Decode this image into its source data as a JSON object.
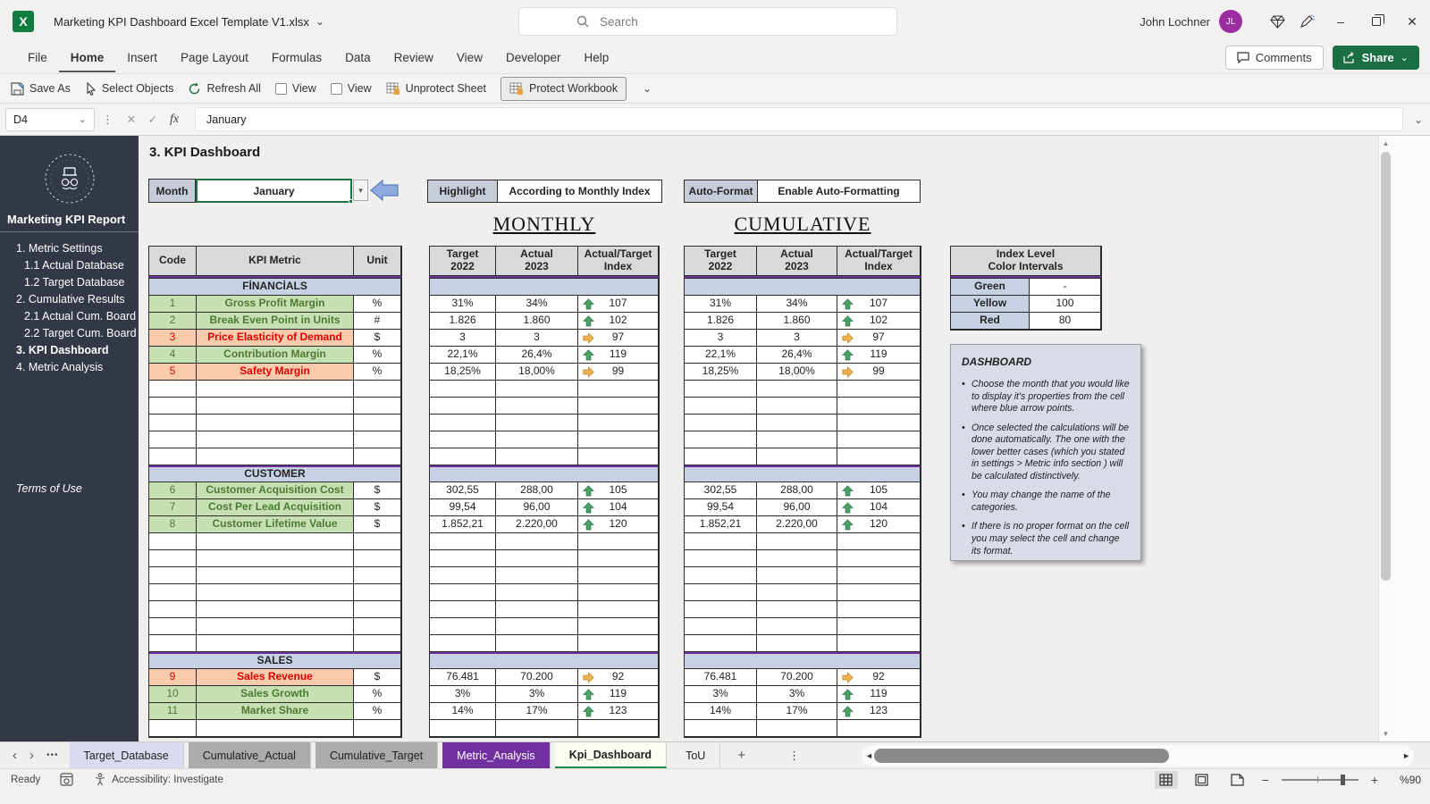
{
  "titlebar": {
    "document_title": "Marketing KPI Dashboard Excel Template V1.xlsx",
    "search_placeholder": "Search",
    "user_name": "John Lochner",
    "user_initials": "JL"
  },
  "menubar": {
    "items": [
      "File",
      "Home",
      "Insert",
      "Page Layout",
      "Formulas",
      "Data",
      "Review",
      "View",
      "Developer",
      "Help"
    ],
    "active_item": "Home",
    "comments_label": "Comments",
    "share_label": "Share"
  },
  "toolbar": {
    "save_as": "Save As",
    "select_objects": "Select Objects",
    "refresh_all": "Refresh All",
    "view_1": "View",
    "view_2": "View",
    "unprotect_sheet": "Unprotect Sheet",
    "protect_workbook": "Protect Workbook"
  },
  "formula_bar": {
    "name_box": "D4",
    "fx_label": "fx",
    "content": "January"
  },
  "sidebar": {
    "report_title": "Marketing KPI Report",
    "items": [
      {
        "label": "1. Metric Settings",
        "level": 0,
        "active": false
      },
      {
        "label": "1.1 Actual Database",
        "level": 1,
        "active": false
      },
      {
        "label": "1.2 Target Database",
        "level": 1,
        "active": false
      },
      {
        "label": "2. Cumulative Results",
        "level": 0,
        "active": false
      },
      {
        "label": "2.1 Actual Cum. Board",
        "level": 1,
        "active": false
      },
      {
        "label": "2.2 Target Cum. Board",
        "level": 1,
        "active": false
      },
      {
        "label": "3. KPI Dashboard",
        "level": 0,
        "active": true
      },
      {
        "label": "4. Metric Analysis",
        "level": 0,
        "active": false
      }
    ],
    "terms_link": "Terms of Use"
  },
  "dashboard": {
    "page_title": "3. KPI Dashboard",
    "month_label": "Month",
    "month_value": "January",
    "highlight_label": "Highlight",
    "highlight_value": "According to Monthly Index",
    "autoformat_label": "Auto-Format",
    "autoformat_value": "Enable Auto-Formatting",
    "monthly_title": "MONTHLY",
    "cumulative_title": "CUMULATIVE",
    "headers": {
      "code": "Code",
      "metric": "KPI Metric",
      "unit": "Unit",
      "target_line1": "Target",
      "target_line2": "2022",
      "actual_line1": "Actual",
      "actual_line2": "2023",
      "index_line1": "Actual/Target",
      "index_line2": "Index"
    },
    "sections": [
      {
        "name": "FİNANCİALS",
        "empty_rows": 5,
        "rows": [
          {
            "code": "1",
            "metric": "Gross Profit Margin",
            "unit": "%",
            "status": "good",
            "monthly": {
              "target": "31%",
              "actual": "34%",
              "index": "107",
              "arrow": "up"
            },
            "cumulative": {
              "target": "31%",
              "actual": "34%",
              "index": "107",
              "arrow": "up"
            }
          },
          {
            "code": "2",
            "metric": "Break Even Point in Units",
            "unit": "#",
            "status": "good",
            "monthly": {
              "target": "1.826",
              "actual": "1.860",
              "index": "102",
              "arrow": "up"
            },
            "cumulative": {
              "target": "1.826",
              "actual": "1.860",
              "index": "102",
              "arrow": "up"
            }
          },
          {
            "code": "3",
            "metric": "Price Elasticity of Demand",
            "unit": "$",
            "status": "bad",
            "monthly": {
              "target": "3",
              "actual": "3",
              "index": "97",
              "arrow": "right"
            },
            "cumulative": {
              "target": "3",
              "actual": "3",
              "index": "97",
              "arrow": "right"
            }
          },
          {
            "code": "4",
            "metric": "Contribution Margin",
            "unit": "%",
            "status": "good",
            "monthly": {
              "target": "22,1%",
              "actual": "26,4%",
              "index": "119",
              "arrow": "up"
            },
            "cumulative": {
              "target": "22,1%",
              "actual": "26,4%",
              "index": "119",
              "arrow": "up"
            }
          },
          {
            "code": "5",
            "metric": "Safety Margin",
            "unit": "%",
            "status": "bad",
            "monthly": {
              "target": "18,25%",
              "actual": "18,00%",
              "index": "99",
              "arrow": "right"
            },
            "cumulative": {
              "target": "18,25%",
              "actual": "18,00%",
              "index": "99",
              "arrow": "right"
            }
          }
        ]
      },
      {
        "name": "CUSTOMER",
        "empty_rows": 7,
        "rows": [
          {
            "code": "6",
            "metric": "Customer Acquisition Cost",
            "unit": "$",
            "status": "good",
            "monthly": {
              "target": "302,55",
              "actual": "288,00",
              "index": "105",
              "arrow": "up"
            },
            "cumulative": {
              "target": "302,55",
              "actual": "288,00",
              "index": "105",
              "arrow": "up"
            }
          },
          {
            "code": "7",
            "metric": "Cost Per Lead Acquisition",
            "unit": "$",
            "status": "good",
            "monthly": {
              "target": "99,54",
              "actual": "96,00",
              "index": "104",
              "arrow": "up"
            },
            "cumulative": {
              "target": "99,54",
              "actual": "96,00",
              "index": "104",
              "arrow": "up"
            }
          },
          {
            "code": "8",
            "metric": "Customer Lifetime Value",
            "unit": "$",
            "status": "good",
            "monthly": {
              "target": "1.852,21",
              "actual": "2.220,00",
              "index": "120",
              "arrow": "up"
            },
            "cumulative": {
              "target": "1.852,21",
              "actual": "2.220,00",
              "index": "120",
              "arrow": "up"
            }
          }
        ]
      },
      {
        "name": "SALES",
        "empty_rows": 1,
        "rows": [
          {
            "code": "9",
            "metric": "Sales Revenue",
            "unit": "$",
            "status": "bad",
            "monthly": {
              "target": "76.481",
              "actual": "70.200",
              "index": "92",
              "arrow": "right"
            },
            "cumulative": {
              "target": "76.481",
              "actual": "70.200",
              "index": "92",
              "arrow": "right"
            }
          },
          {
            "code": "10",
            "metric": "Sales Growth",
            "unit": "%",
            "status": "good",
            "monthly": {
              "target": "3%",
              "actual": "3%",
              "index": "119",
              "arrow": "up"
            },
            "cumulative": {
              "target": "3%",
              "actual": "3%",
              "index": "119",
              "arrow": "up"
            }
          },
          {
            "code": "11",
            "metric": "Market Share",
            "unit": "%",
            "status": "good",
            "monthly": {
              "target": "14%",
              "actual": "17%",
              "index": "123",
              "arrow": "up"
            },
            "cumulative": {
              "target": "14%",
              "actual": "17%",
              "index": "123",
              "arrow": "up"
            }
          }
        ]
      }
    ],
    "index_levels": {
      "header_line1": "Index Level",
      "header_line2": "Color Intervals",
      "rows": [
        {
          "label": "Green",
          "value": "-"
        },
        {
          "label": "Yellow",
          "value": "100"
        },
        {
          "label": "Red",
          "value": "80"
        }
      ]
    },
    "info_box": {
      "title": "DASHBOARD",
      "bullets": [
        "Choose the month that you would like to display it's properties from the cell where blue arrow points.",
        "Once selected the calculations will be done automatically. The one with the lower better cases (which you stated in settings > Metric info section ) will be calculated distinctively.",
        "You may change the name of the categories.",
        "If there is no proper format on the cell you may select the cell and change its format."
      ]
    }
  },
  "sheet_tabs": {
    "tabs": [
      {
        "label": "Target_Database",
        "style": "lavender"
      },
      {
        "label": "Cumulative_Actual",
        "style": "gray"
      },
      {
        "label": "Cumulative_Target",
        "style": "gray"
      },
      {
        "label": "Metric_Analysis",
        "style": "purple"
      },
      {
        "label": "Kpi_Dashboard",
        "style": "active"
      },
      {
        "label": "ToU",
        "style": "plain"
      }
    ]
  },
  "status_bar": {
    "ready": "Ready",
    "accessibility": "Accessibility: Investigate",
    "zoom_level": "%90"
  },
  "icons": {
    "chevron_down": "⌄",
    "dropdown_arrow": "▾",
    "more_vertical": "⋮",
    "more_horizontal": "•••",
    "cancel": "✕",
    "check": "✓",
    "minimize": "–",
    "close": "✕",
    "scroll_up": "▲",
    "scroll_down": "▼",
    "scroll_left": "◄",
    "scroll_right": "►",
    "tab_prev": "‹",
    "tab_next": "›",
    "plus": "+"
  },
  "colors": {
    "excel_green": "#107C41",
    "selection_green": "#1E7145",
    "purple_accent": "#7030A0",
    "band_blue": "#C8D1E4",
    "good_bg": "#C6E0B4",
    "good_text": "#4E7A33",
    "bad_bg": "#F8CBAD",
    "bad_text": "#E00000",
    "header_gray": "#D9D9D9",
    "label_gray": "#C6CCD8",
    "sidebar_bg": "#323846",
    "arrow_up_green": "#4DA167",
    "arrow_right_amber": "#EFB44E",
    "avatar_purple": "#9A2DA0"
  }
}
